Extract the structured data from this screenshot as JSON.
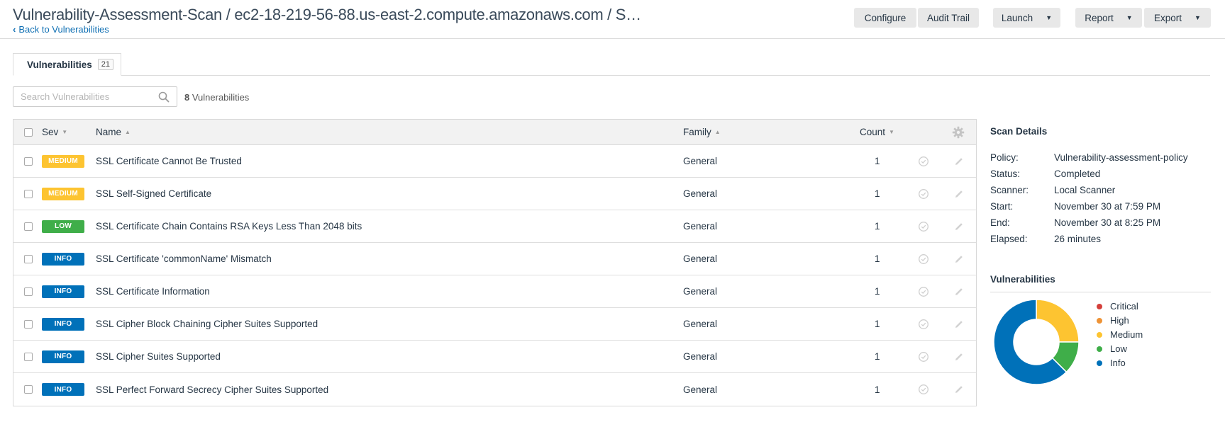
{
  "header": {
    "title": "Vulnerability-Assessment-Scan / ec2-18-219-56-88.us-east-2.compute.amazonaws.com / S…",
    "back_link": "Back to Vulnerabilities",
    "buttons": {
      "configure": "Configure",
      "audit_trail": "Audit Trail",
      "launch": "Launch",
      "report": "Report",
      "export": "Export"
    }
  },
  "tabs": [
    {
      "label": "Vulnerabilities",
      "count": "21"
    }
  ],
  "search": {
    "placeholder": "Search Vulnerabilities",
    "value": ""
  },
  "result_count": {
    "number": "8",
    "label": "Vulnerabilities"
  },
  "table": {
    "columns": {
      "sev": "Sev",
      "name": "Name",
      "family": "Family",
      "count": "Count"
    },
    "rows": [
      {
        "severity": "MEDIUM",
        "name": "SSL Certificate Cannot Be Trusted",
        "family": "General",
        "count": "1"
      },
      {
        "severity": "MEDIUM",
        "name": "SSL Self-Signed Certificate",
        "family": "General",
        "count": "1"
      },
      {
        "severity": "LOW",
        "name": "SSL Certificate Chain Contains RSA Keys Less Than 2048 bits",
        "family": "General",
        "count": "1"
      },
      {
        "severity": "INFO",
        "name": "SSL Certificate 'commonName' Mismatch",
        "family": "General",
        "count": "1"
      },
      {
        "severity": "INFO",
        "name": "SSL Certificate Information",
        "family": "General",
        "count": "1"
      },
      {
        "severity": "INFO",
        "name": "SSL Cipher Block Chaining Cipher Suites Supported",
        "family": "General",
        "count": "1"
      },
      {
        "severity": "INFO",
        "name": "SSL Cipher Suites Supported",
        "family": "General",
        "count": "1"
      },
      {
        "severity": "INFO",
        "name": "SSL Perfect Forward Secrecy Cipher Suites Supported",
        "family": "General",
        "count": "1"
      }
    ]
  },
  "severity_colors": {
    "CRITICAL": "#d43f3a",
    "HIGH": "#ee9336",
    "MEDIUM": "#fdc431",
    "LOW": "#3fae49",
    "INFO": "#0071b9"
  },
  "scan_details": {
    "title": "Scan Details",
    "fields": [
      {
        "label": "Policy:",
        "value": "Vulnerability-assessment-policy"
      },
      {
        "label": "Status:",
        "value": "Completed"
      },
      {
        "label": "Scanner:",
        "value": "Local Scanner"
      },
      {
        "label": "Start:",
        "value": "November 30 at 7:59 PM"
      },
      {
        "label": "End:",
        "value": "November 30 at 8:25 PM"
      },
      {
        "label": "Elapsed:",
        "value": "26 minutes"
      }
    ]
  },
  "vulnerabilities_panel": {
    "title": "Vulnerabilities",
    "legend": [
      "Critical",
      "High",
      "Medium",
      "Low",
      "Info"
    ]
  },
  "chart_data": {
    "type": "pie",
    "title": "",
    "categories": [
      "Critical",
      "High",
      "Medium",
      "Low",
      "Info"
    ],
    "values": [
      0,
      0,
      2,
      1,
      5
    ],
    "colors": [
      "#d43f3a",
      "#ee9336",
      "#fdc431",
      "#3fae49",
      "#0071b9"
    ]
  },
  "icons": {
    "row_actions": [
      "check-circle-icon",
      "pencil-icon"
    ],
    "header_settings": "gear-icon",
    "search": "search-icon"
  }
}
